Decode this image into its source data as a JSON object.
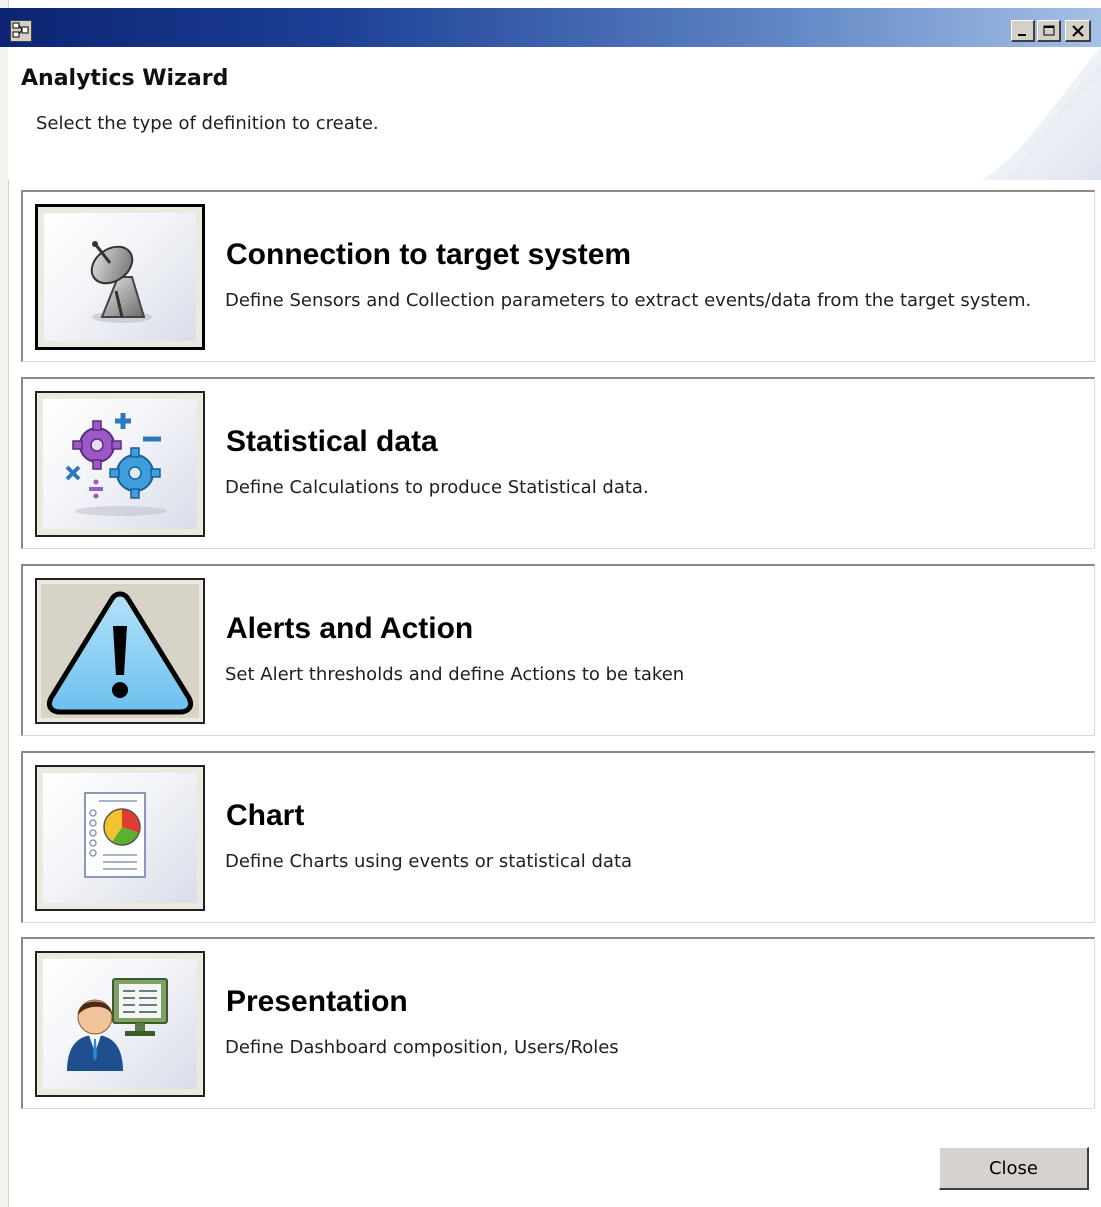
{
  "window": {
    "title": "",
    "controls": {
      "minimize": "minimize",
      "maximize": "maximize",
      "close": "close"
    }
  },
  "header": {
    "title": "Analytics Wizard",
    "subtitle": "Select the type of definition to create."
  },
  "options": [
    {
      "title": "Connection to target system",
      "description": "Define Sensors and Collection parameters to extract events/data from the target system.",
      "icon": "satellite-dish-icon",
      "selected": true
    },
    {
      "title": "Statistical data",
      "description": "Define Calculations to produce Statistical data.",
      "icon": "calculation-gears-icon",
      "selected": false
    },
    {
      "title": "Alerts and Action",
      "description": "Set Alert thresholds and define Actions to be taken",
      "icon": "warning-triangle-icon",
      "selected": false
    },
    {
      "title": "Chart",
      "description": "Define Charts using events or statistical data",
      "icon": "pie-chart-document-icon",
      "selected": false
    },
    {
      "title": "Presentation",
      "description": "Define Dashboard composition, Users/Roles",
      "icon": "user-presentation-icon",
      "selected": false
    }
  ],
  "footer": {
    "close_label": "Close"
  },
  "colors": {
    "titlebar_start": "#0c2473",
    "titlebar_end": "#a6c0e6",
    "alert_blue": "#8fd0f5",
    "button_face": "#d6d3ce"
  }
}
